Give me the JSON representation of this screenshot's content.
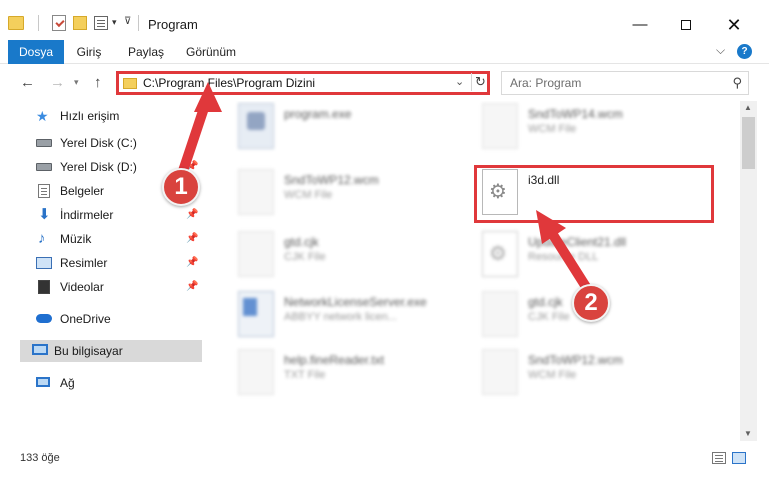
{
  "window": {
    "title": "Program",
    "minimize_glyph": "—",
    "close_glyph": "✕"
  },
  "ribbon": {
    "tabs": [
      "Dosya",
      "Giriş",
      "Paylaş",
      "Görünüm"
    ],
    "help_glyph": "?"
  },
  "address": {
    "path": "C:\\Program Files\\Program Dizini",
    "search_placeholder": "Ara: Program"
  },
  "sidebar": {
    "items": [
      {
        "label": "Hızlı erişim",
        "icon": "star-icon",
        "pinned": false
      },
      {
        "label": "Yerel Disk (C:)",
        "icon": "disk-icon",
        "pinned": false
      },
      {
        "label": "Yerel Disk (D:)",
        "icon": "disk-icon",
        "pinned": true
      },
      {
        "label": "Belgeler",
        "icon": "documents-icon",
        "pinned": true
      },
      {
        "label": "İndirmeler",
        "icon": "download-icon",
        "pinned": true
      },
      {
        "label": "Müzik",
        "icon": "music-icon",
        "pinned": true
      },
      {
        "label": "Resimler",
        "icon": "pictures-icon",
        "pinned": true
      },
      {
        "label": "Videolar",
        "icon": "video-icon",
        "pinned": true
      },
      {
        "label": "OneDrive",
        "icon": "cloud-icon",
        "pinned": false
      },
      {
        "label": "Bu bilgisayar",
        "icon": "computer-icon",
        "pinned": false,
        "selected": true
      },
      {
        "label": "Ağ",
        "icon": "network-icon",
        "pinned": false
      }
    ]
  },
  "files": [
    {
      "name": "program.exe",
      "type": ""
    },
    {
      "name": "SndToWP14.wcm",
      "type": "WCM File"
    },
    {
      "name": "SndToWP12.wcm",
      "type": "WCM File"
    },
    {
      "name": "i3d.dll",
      "type": "",
      "highlighted": true
    },
    {
      "name": "gtd.cjk",
      "type": "CJK File"
    },
    {
      "name": "UpdateClient21.dll",
      "type": "Resource DLL"
    },
    {
      "name": "NetworkLicenseServer.exe",
      "type": "ABBYY network licen..."
    },
    {
      "name": "gtd.cjk",
      "type": "CJK File"
    },
    {
      "name": "help.fineReader.txt",
      "type": "TXT File"
    },
    {
      "name": "SndToWP12.wcm",
      "type": "WCM File"
    }
  ],
  "annotations": {
    "step1": "1",
    "step2": "2",
    "color": "#e0383b"
  },
  "status": {
    "item_count": "133 öğe"
  }
}
